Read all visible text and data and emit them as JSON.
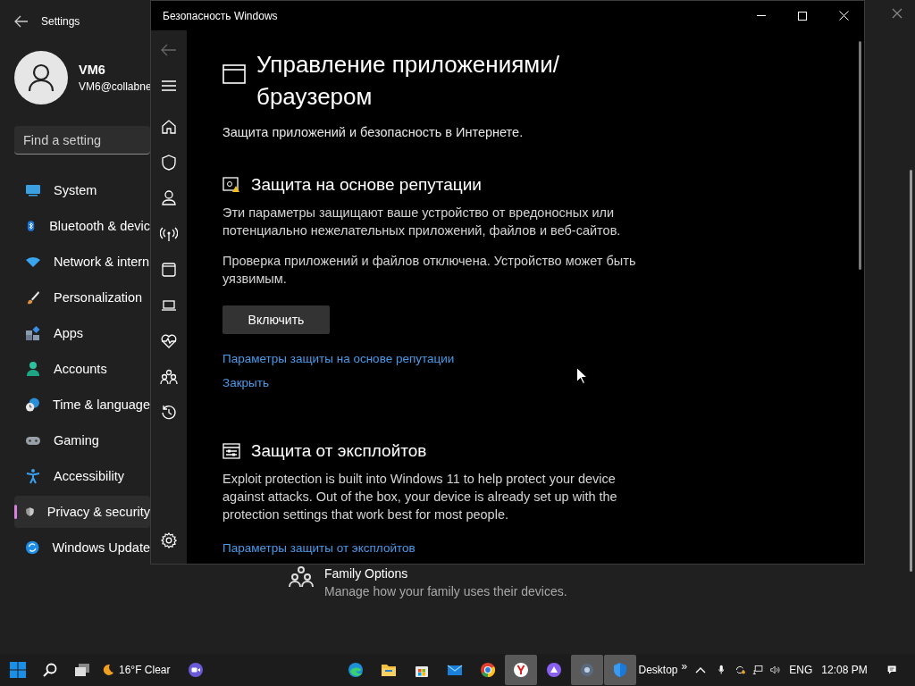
{
  "settings": {
    "title": "Settings",
    "user": {
      "name": "VM6",
      "email": "VM6@collabne"
    },
    "search": {
      "placeholder": "Find a setting"
    },
    "nav": [
      {
        "label": "System",
        "selected": false
      },
      {
        "label": "Bluetooth & devic",
        "selected": false
      },
      {
        "label": "Network & intern",
        "selected": false
      },
      {
        "label": "Personalization",
        "selected": false
      },
      {
        "label": "Apps",
        "selected": false
      },
      {
        "label": "Accounts",
        "selected": false
      },
      {
        "label": "Time & language",
        "selected": false
      },
      {
        "label": "Gaming",
        "selected": false
      },
      {
        "label": "Accessibility",
        "selected": false
      },
      {
        "label": "Privacy & security",
        "selected": true
      },
      {
        "label": "Windows Update",
        "selected": false
      }
    ],
    "family": {
      "title": "Family Options",
      "description": "Manage how your family uses their devices."
    }
  },
  "security_window": {
    "title": "Безопасность Windows",
    "page": {
      "title_lines": [
        "Управление приложениями/",
        "браузером"
      ],
      "subtitle": "Защита приложений и безопасность в Интернете.",
      "sections": [
        {
          "title": "Защита на основе репутации",
          "paragraphs": [
            "Эти параметры защищают ваше устройство от вредоносных или потенциально нежелательных приложений, файлов и веб-сайтов.",
            "Проверка приложений и файлов отключена. Устройство может быть уязвимым."
          ],
          "button": "Включить",
          "links": [
            "Параметры защиты на основе репутации",
            "Закрыть"
          ]
        },
        {
          "title": "Защита от эксплойтов",
          "paragraphs": [
            "Exploit protection is built into Windows 11 to help protect your device against attacks.  Out of the box, your device is already set up with the protection settings that work best for most people."
          ],
          "links": [
            "Параметры защиты от эксплойтов"
          ]
        }
      ]
    }
  },
  "taskbar": {
    "weather": "16°F Clear",
    "pinned": [
      {
        "active": false
      },
      {
        "active": false
      },
      {
        "active": false
      },
      {
        "active": false
      },
      {
        "active": false
      },
      {
        "active": true
      },
      {
        "active": false
      },
      {
        "active": true
      },
      {
        "active": true
      }
    ],
    "desktop_label": "Desktop",
    "chevron": "»",
    "language": "ENG",
    "time": "12:08 PM"
  }
}
